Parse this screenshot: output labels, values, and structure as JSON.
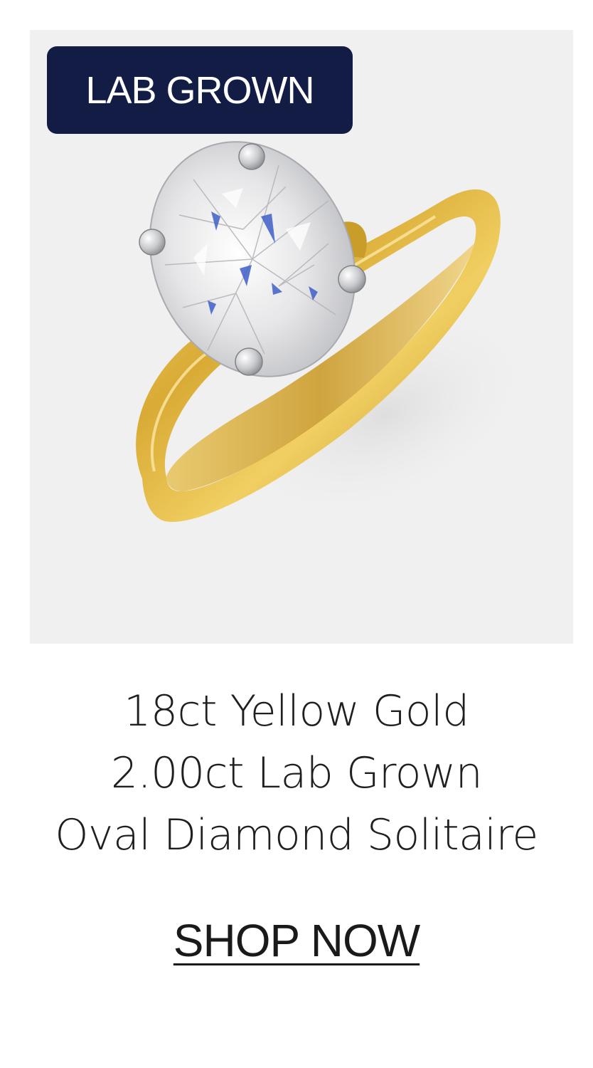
{
  "product": {
    "badge": "LAB GROWN",
    "image_alt": "Oval diamond solitaire ring on yellow gold band",
    "title_lines": [
      "18ct Yellow Gold",
      "2.00ct Lab Grown",
      "Oval Diamond Solitaire"
    ],
    "cta_label": "SHOP NOW"
  },
  "colors": {
    "badge_bg": "#121c45",
    "panel_bg": "#f0f0f0",
    "gold": "#d9b13e",
    "text": "#1f1f1f"
  }
}
